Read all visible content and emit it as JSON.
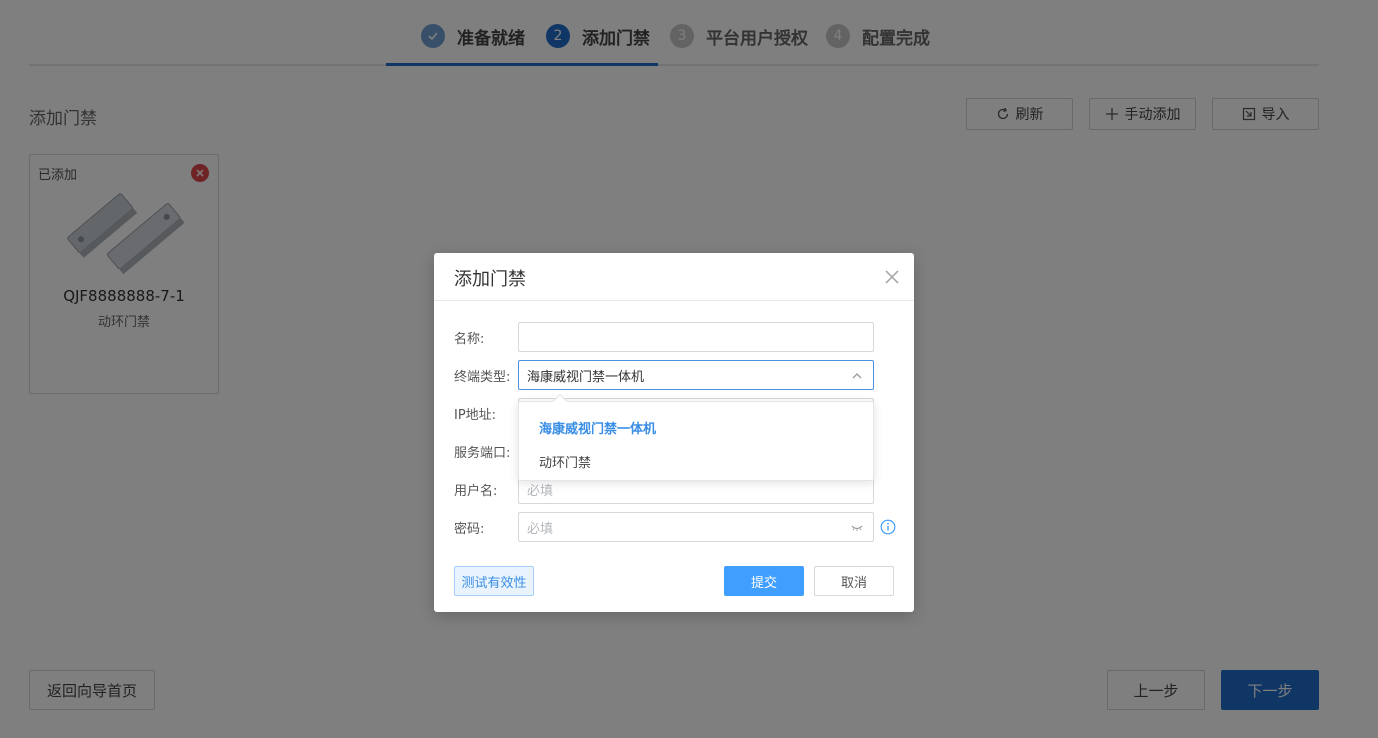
{
  "steps": [
    {
      "number": "✓",
      "label": "准备就绪",
      "state": "done"
    },
    {
      "number": "2",
      "label": "添加门禁",
      "state": "active"
    },
    {
      "number": "3",
      "label": "平台用户授权",
      "state": "todo"
    },
    {
      "number": "4",
      "label": "配置完成",
      "state": "todo"
    }
  ],
  "section": {
    "title": "添加门禁"
  },
  "toolbar": {
    "refresh": "刷新",
    "manual_add": "手动添加",
    "import": "导入"
  },
  "card": {
    "tag": "已添加",
    "name": "QJF8888888-7-1",
    "type": "动环门禁"
  },
  "footer": {
    "back_home": "返回向导首页",
    "prev": "上一步",
    "next": "下一步"
  },
  "modal": {
    "title": "添加门禁",
    "fields": {
      "name": {
        "label": "名称:",
        "value": ""
      },
      "terminal_type": {
        "label": "终端类型:",
        "value": "海康威视门禁一体机"
      },
      "ip": {
        "label": "IP地址:"
      },
      "port": {
        "label": "服务端口:"
      },
      "username": {
        "label": "用户名:",
        "placeholder": "必填"
      },
      "password": {
        "label": "密码:",
        "placeholder": "必填"
      }
    },
    "dropdown_options": [
      {
        "label": "海康威视门禁一体机",
        "selected": true
      },
      {
        "label": "动环门禁",
        "selected": false
      }
    ],
    "buttons": {
      "test": "测试有效性",
      "submit": "提交",
      "cancel": "取消"
    }
  },
  "colors": {
    "primary": "#1f6dc9",
    "accent": "#409eff",
    "danger": "#e0464a"
  }
}
